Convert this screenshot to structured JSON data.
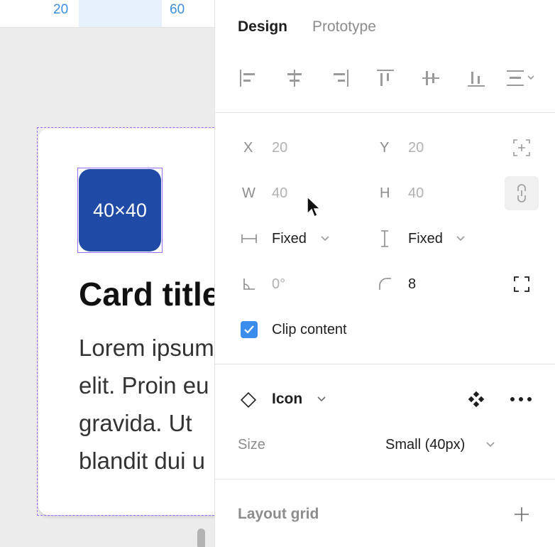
{
  "ruler": {
    "mark_20": "20",
    "mark_60": "60"
  },
  "card": {
    "icon_label": "40×40",
    "title": "Card title",
    "body_lines": [
      "Lorem ipsum dolor sit amet,",
      "elit. Proin eu",
      "gravida. Ut",
      "blandit dui u"
    ]
  },
  "tabs": {
    "design": "Design",
    "prototype": "Prototype"
  },
  "position": {
    "x_label": "X",
    "x_value": "20",
    "y_label": "Y",
    "y_value": "20"
  },
  "size": {
    "w_label": "W",
    "w_value": "40",
    "h_label": "H",
    "h_value": "40"
  },
  "resizing": {
    "horizontal": "Fixed",
    "vertical": "Fixed"
  },
  "rotation": {
    "value": "0°"
  },
  "corner_radius": {
    "value": "8"
  },
  "clip": {
    "label": "Clip content",
    "checked": true
  },
  "component": {
    "name": "Icon",
    "size_label": "Size",
    "size_value": "Small (40px)"
  },
  "layout_grid": {
    "title": "Layout grid"
  },
  "colors": {
    "accent": "#3b8ded",
    "selection": "#9b6bff",
    "icon_fill": "#1f4ba6"
  }
}
